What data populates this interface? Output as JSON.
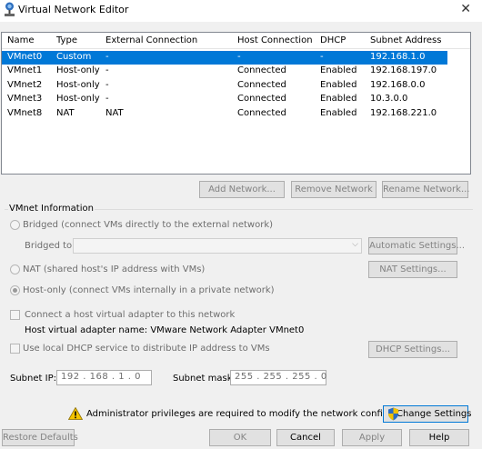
{
  "window": {
    "title": "Virtual Network Editor",
    "close_glyph": "✕"
  },
  "table": {
    "columns": [
      "Name",
      "Type",
      "External Connection",
      "Host Connection",
      "DHCP",
      "Subnet Address"
    ],
    "rows": [
      [
        "VMnet0",
        "Custom",
        "-",
        "-",
        "-",
        "192.168.1.0"
      ],
      [
        "VMnet1",
        "Host-only",
        "-",
        "Connected",
        "Enabled",
        "192.168.197.0"
      ],
      [
        "VMnet2",
        "Host-only",
        "-",
        "Connected",
        "Enabled",
        "192.168.0.0"
      ],
      [
        "VMnet3",
        "Host-only",
        "-",
        "Connected",
        "Enabled",
        "10.3.0.0"
      ],
      [
        "VMnet8",
        "NAT",
        "NAT",
        "Connected",
        "Enabled",
        "192.168.221.0"
      ]
    ],
    "selected_row": 0
  },
  "list_buttons": {
    "add": "Add Network...",
    "remove": "Remove Network",
    "rename": "Rename Network..."
  },
  "vmnet_info": {
    "title": "VMnet Information",
    "bridged_label": "Bridged (connect VMs directly to the external network)",
    "bridged_to_label": "Bridged to:",
    "bridged_to_value": "",
    "automatic_settings": "Automatic Settings...",
    "nat_label": "NAT (shared host's IP address with VMs)",
    "nat_settings": "NAT Settings...",
    "hostonly_label": "Host-only (connect VMs internally in a private network)",
    "selected_mode": "host-only",
    "connect_adapter_label": "Connect a host virtual adapter to this network",
    "connect_adapter_checked": false,
    "adapter_name_text": "Host virtual adapter name: VMware Network Adapter VMnet0",
    "dhcp_label": "Use local DHCP service to distribute IP address to VMs",
    "dhcp_checked": false,
    "dhcp_settings": "DHCP Settings...",
    "subnet_ip_label": "Subnet IP:",
    "subnet_ip_value": "192 . 168 .  1  .  0",
    "subnet_mask_label": "Subnet mask:",
    "subnet_mask_value": "255 . 255 . 255 .  0"
  },
  "admin": {
    "message": "Administrator privileges are required to modify the network configuration.",
    "change_settings": "Change Settings"
  },
  "footer": {
    "restore": "Restore Defaults",
    "ok": "OK",
    "cancel": "Cancel",
    "apply": "Apply",
    "help": "Help"
  },
  "colors": {
    "selection": "#0078d7",
    "warning": "#f5c400"
  }
}
